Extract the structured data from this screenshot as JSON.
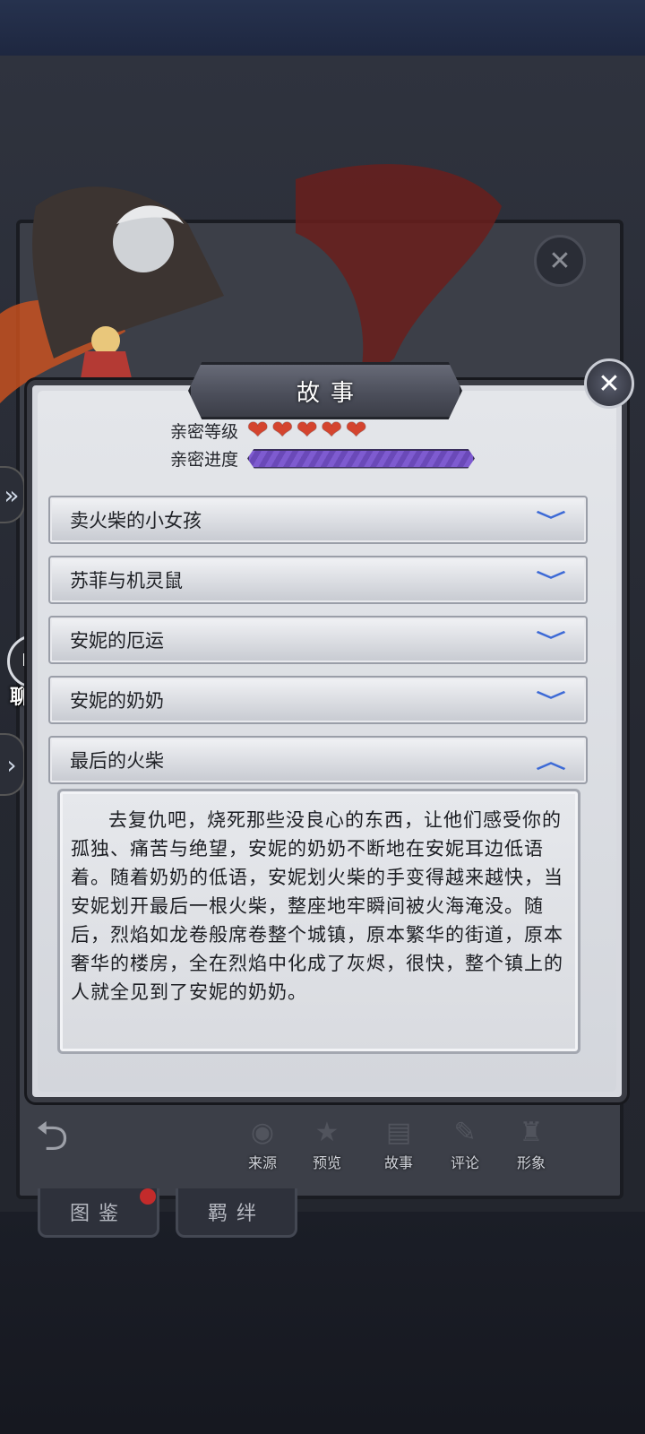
{
  "dialog": {
    "title": "故事",
    "close_label": "✕"
  },
  "intimacy": {
    "level_label": "亲密等级",
    "hearts_filled": 5,
    "hearts_total": 5,
    "progress_label": "亲密进度",
    "progress_fraction": 1.0
  },
  "stories": [
    {
      "title": "卖火柴的小女孩",
      "expanded": false
    },
    {
      "title": "苏菲与机灵鼠",
      "expanded": false
    },
    {
      "title": "安妮的厄运",
      "expanded": false
    },
    {
      "title": "安妮的奶奶",
      "expanded": false
    },
    {
      "title": "最后的火柴",
      "expanded": true
    }
  ],
  "expanded_story_text": "去复仇吧，烧死那些没良心的东西，让他们感受你的孤独、痛苦与绝望，安妮的奶奶不断地在安妮耳边低语着。随着奶奶的低语，安妮划火柴的手变得越来越快，当安妮划开最后一根火柴，整座地牢瞬间被火海淹没。随后，烈焰如龙卷般席卷整个城镇，原本繁华的街道，原本奢华的楼房，全在烈焰中化成了灰烬，很快，整个镇上的人就全见到了安妮的奶奶。",
  "chat": {
    "badge": "1",
    "label": "聊天"
  },
  "toolbar": {
    "tools": [
      {
        "label": "来源",
        "icon": "source-icon"
      },
      {
        "label": "预览",
        "icon": "star-icon"
      },
      {
        "label": "故事",
        "icon": "book-icon"
      },
      {
        "label": "评论",
        "icon": "quill-icon"
      },
      {
        "label": "形象",
        "icon": "hat-icon"
      }
    ]
  },
  "bottom_tabs": {
    "gallery": "图鉴",
    "bonds": "羁绊"
  },
  "colors": {
    "heart": "#d4442e",
    "progress": "#7e5bd0",
    "chevron": "#3d6ad6",
    "badge": "#c8281f"
  }
}
